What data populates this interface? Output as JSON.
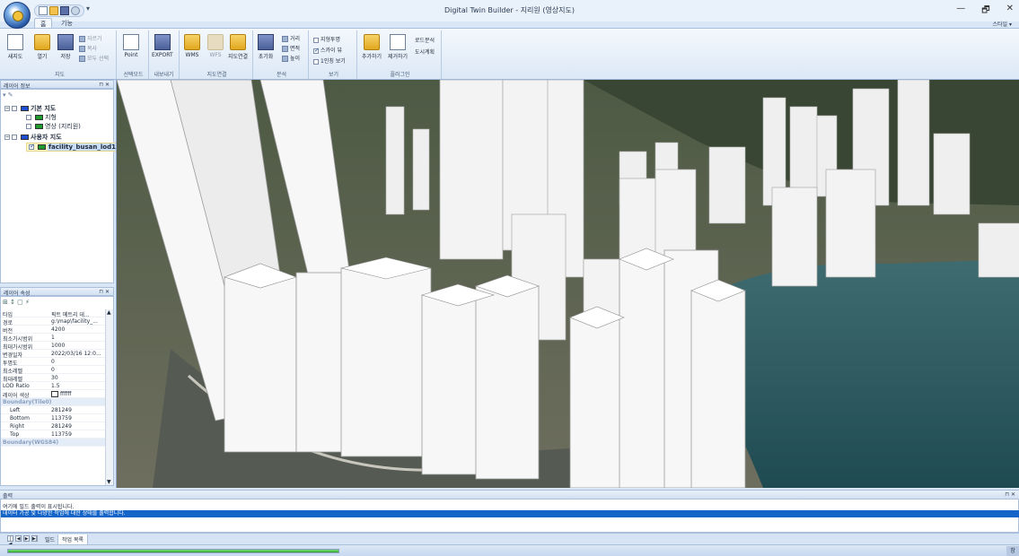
{
  "window": {
    "title": "Digital Twin Builder - 지리원 (영상지도)",
    "controls": [
      "—",
      "🗗",
      "✕"
    ],
    "qat_dropdown": "▾"
  },
  "ribbon_tabs": {
    "home": "홈",
    "func": "기능",
    "style_menu": "스타일 ▾"
  },
  "ribbon": {
    "map_group": {
      "caption": "지도",
      "new": "새지도",
      "open": "열기",
      "save": "저장",
      "cut": "자르기",
      "copy": "복사",
      "select_all": "모두 선택"
    },
    "select_group": {
      "caption": "선택모드",
      "point": "Point"
    },
    "export_group": {
      "caption": "내보내기",
      "export": "EXPORT"
    },
    "connect_group": {
      "caption": "지도연결",
      "wms": "WMS",
      "wfs": "WFS",
      "mapconnect": "지도연결"
    },
    "analysis_group": {
      "caption": "분석",
      "init": "초기화",
      "distance": "거리",
      "area": "면적",
      "height": "높이"
    },
    "view_group": {
      "caption": "보기",
      "terrain_transparent": "지형투명",
      "terrain_checked": false,
      "sky": "스카이 뷰",
      "sky_checked": true,
      "first_person": "1인칭 보기",
      "first_checked": false
    },
    "plugin_group": {
      "caption": "플러그인",
      "add": "추가하기",
      "remove": "제거하기",
      "shadow": "로드분석",
      "city": "도시계획"
    }
  },
  "layer_panel": {
    "title": "레이어 정보",
    "pin": "⊓ ✕",
    "tree": {
      "base_map": "기본 지도",
      "terrain": "지형",
      "imagery": "영상 (지리원)",
      "user_map": "사용자 지도",
      "facility": "facility_busan_lod1"
    }
  },
  "prop_panel": {
    "title": "레이어 속성",
    "pin": "⊓ ✕",
    "rows": [
      {
        "k": "타입",
        "v": "픽트 메트리 데..."
      },
      {
        "k": "경로",
        "v": "g:\\map\\facility_..."
      },
      {
        "k": "버전",
        "v": "4200"
      },
      {
        "k": "최소가시범위",
        "v": "1"
      },
      {
        "k": "최대가시범위",
        "v": "1000"
      },
      {
        "k": "변경일자",
        "v": "2022/03/16 12:0..."
      },
      {
        "k": "투명도",
        "v": "0"
      },
      {
        "k": "최소레벨",
        "v": "0"
      },
      {
        "k": "최대레벨",
        "v": "30"
      },
      {
        "k": "LOD Ratio",
        "v": "1.5"
      },
      {
        "k": "레이어 색상",
        "v": "ffffff"
      }
    ],
    "cat_tile": "Boundary(Tile0)",
    "tile_rows": [
      {
        "k": "Left",
        "v": "281249"
      },
      {
        "k": "Bottom",
        "v": "113759"
      },
      {
        "k": "Right",
        "v": "281249"
      },
      {
        "k": "Top",
        "v": "113759"
      }
    ],
    "cat_wgs": "Boundary(WGS84)"
  },
  "output": {
    "title": "출력",
    "pin": "⊓ ✕",
    "line1": "여기에 빌드 출력이 표시됩니다.",
    "line2": "데이터 가공 및 다양한 작업에 대한 상태를 출력합니다."
  },
  "bottom_tabs": {
    "build": "빌드",
    "work": "작업 목록"
  },
  "status": {
    "progress": 1.0,
    "right": "창"
  },
  "colors": {
    "accent": "#1565c8",
    "ribbon": "#dce8f6",
    "sea": "#2f5a60",
    "building": "#f4f4f4"
  }
}
